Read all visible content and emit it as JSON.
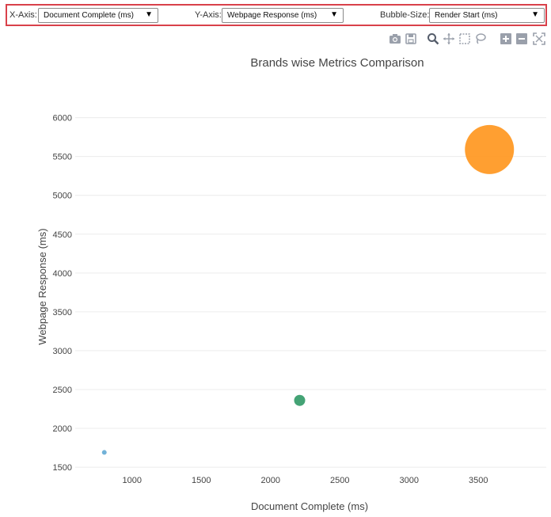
{
  "controls": {
    "x_axis_label": "X-Axis:",
    "x_axis_value": "Document Complete (ms)",
    "y_axis_label": "Y-Axis:",
    "y_axis_value": "Webpage Response (ms)",
    "bubble_label": "Bubble-Size:",
    "bubble_value": "Render Start (ms)",
    "dropdown_arrow": "▼"
  },
  "modebar": {
    "icons": [
      "camera-icon",
      "save-icon",
      "zoom-icon",
      "pan-icon",
      "box-select-icon",
      "lasso-icon",
      "zoom-in-icon",
      "zoom-out-icon",
      "autoscale-icon"
    ],
    "icon_color": "#9aa0ab"
  },
  "chart_data": {
    "type": "scatter",
    "title": "Brands wise Metrics Comparison",
    "xlabel": "Document Complete (ms)",
    "ylabel": "Webpage Response (ms)",
    "xlim": [
      590,
      3990
    ],
    "ylim": [
      1460,
      6210
    ],
    "xticks": [
      1000,
      1500,
      2000,
      2500,
      3000,
      3500
    ],
    "yticks": [
      1500,
      2000,
      2500,
      3000,
      3500,
      4000,
      4500,
      5000,
      5500,
      6000
    ],
    "grid": true,
    "points": [
      {
        "x": 800,
        "y": 1690,
        "size": 3,
        "color": "#6aaed6"
      },
      {
        "x": 2210,
        "y": 2360,
        "size": 7,
        "color": "#3a9e6e"
      },
      {
        "x": 3580,
        "y": 5590,
        "size": 31,
        "color": "#ff9a26"
      }
    ]
  }
}
